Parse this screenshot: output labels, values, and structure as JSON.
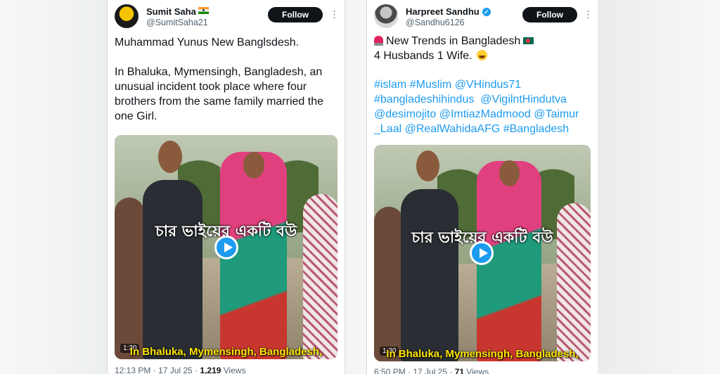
{
  "left_tweet": {
    "author_name": "Sumit Saha",
    "author_handle": "@SumitSaha21",
    "follow_label": "Follow",
    "more_label": "⋮",
    "text": "Muhammad Yunus New Banglsdesh.\n\nIn Bhaluka, Mymensingh, Bangladesh, an\nunusual incident took place where four\nbrothers from the same family married the\none Girl.",
    "video_overlay_text": "চার ভাইয়ের একটি বউ",
    "video_subtitle": "In Bhaluka, Mymensingh, Bangladesh,",
    "video_duration": "1:30",
    "meta_time": "12:13 PM · 17 Jul 25 · ",
    "meta_views_count": "1,219",
    "meta_views_label": " Views"
  },
  "right_tweet": {
    "author_name": "Harpreet Sandhu",
    "author_handle": "@Sandhu6126",
    "follow_label": "Follow",
    "more_label": "⋮",
    "text_line1": "New Trends in Bangladesh",
    "text_line2": "4 Husbands 1 Wife.",
    "hashtags": "#islam #Muslim @VHindus71\n#bangladeshihindus  @VigilntHindutva\n@desimojito @ImtiazMadmood @Taimur\n_Laal @RealWahidaAFG #Bangladesh",
    "video_overlay_text": "চার ভাইয়ের একটি বউ",
    "video_subtitle": "In Bhaluka, Mymensingh, Bangladesh,",
    "video_duration": "1:30",
    "meta_time": "6:50 PM · 17 Jul 25 · ",
    "meta_views_count": "71",
    "meta_views_label": " Views"
  },
  "icons": {
    "left_flag": "india-flag-icon",
    "verified": "verified-badge-icon",
    "siren": "police-light-icon",
    "bd_flag": "bangladesh-flag-icon",
    "laugh": "grinning-sweat-icon",
    "play": "play-icon"
  },
  "colors": {
    "follow_bg": "#0f1419",
    "link_blue": "#1d9bf0",
    "subtitle_yellow": "#ffe600"
  }
}
